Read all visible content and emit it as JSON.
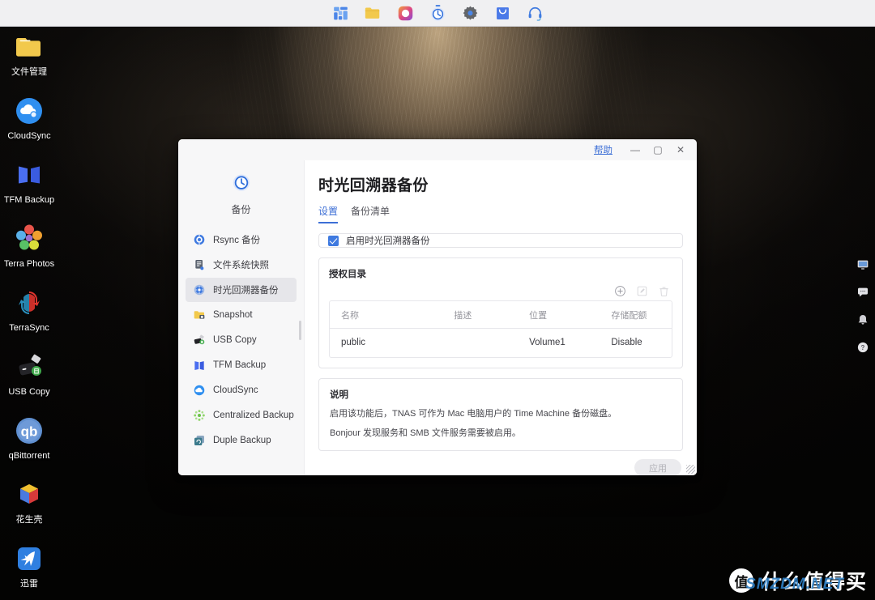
{
  "taskbar": {
    "items": [
      {
        "name": "app-launcher-icon",
        "label": "应用中心"
      },
      {
        "name": "file-manager-icon",
        "label": "文件管理"
      },
      {
        "name": "control-panel-icon",
        "label": "控制面板"
      },
      {
        "name": "backup-icon",
        "label": "备份"
      },
      {
        "name": "settings-gear-icon",
        "label": "设置"
      },
      {
        "name": "download-icon",
        "label": "下载"
      },
      {
        "name": "support-headset-icon",
        "label": "支持"
      }
    ]
  },
  "desktop": {
    "icons": [
      {
        "name": "file-manager",
        "label": "文件管理"
      },
      {
        "name": "cloudsync",
        "label": "CloudSync"
      },
      {
        "name": "tfm-backup",
        "label": "TFM Backup"
      },
      {
        "name": "terra-photos",
        "label": "Terra Photos"
      },
      {
        "name": "terrasync",
        "label": "TerraSync"
      },
      {
        "name": "usb-copy",
        "label": "USB Copy"
      },
      {
        "name": "qbittorrent",
        "label": "qBittorrent"
      },
      {
        "name": "oray-peanut-shell",
        "label": "花生壳"
      },
      {
        "name": "thunder-xunlei",
        "label": "迅雷"
      }
    ]
  },
  "side_tools": [
    {
      "name": "remote-desktop-icon",
      "label": "远程"
    },
    {
      "name": "chat-bubble-icon",
      "label": "消息"
    },
    {
      "name": "notification-bell-icon",
      "label": "通知"
    },
    {
      "name": "help-question-icon",
      "label": "帮助"
    }
  ],
  "window": {
    "help_label": "帮助",
    "minimize_label": "—",
    "maximize_label": "▢",
    "close_label": "✕"
  },
  "nav": {
    "header_label": "备份",
    "items": [
      {
        "label": "Rsync 备份",
        "icon": "rsync-icon",
        "active": false
      },
      {
        "label": "文件系统快照",
        "icon": "filesystem-snapshot-icon",
        "active": false
      },
      {
        "label": "时光回溯器备份",
        "icon": "time-machine-icon",
        "active": true
      },
      {
        "label": "Snapshot",
        "icon": "snapshot-folder-icon",
        "active": false
      },
      {
        "label": "USB Copy",
        "icon": "usb-copy-icon",
        "active": false
      },
      {
        "label": "TFM Backup",
        "icon": "tfm-backup-icon",
        "active": false
      },
      {
        "label": "CloudSync",
        "icon": "cloudsync-icon",
        "active": false
      },
      {
        "label": "Centralized Backup",
        "icon": "centralized-backup-icon",
        "active": false
      },
      {
        "label": "Duple Backup",
        "icon": "duple-backup-icon",
        "active": false
      }
    ]
  },
  "main": {
    "title": "时光回溯器备份",
    "tabs": [
      {
        "label": "设置",
        "active": true
      },
      {
        "label": "备份清单",
        "active": false
      }
    ],
    "enable": {
      "label": "启用时光回溯器备份",
      "checked": true
    },
    "dirs": {
      "title": "授权目录",
      "actions": [
        {
          "name": "add-directory-button",
          "glyph": "⊕",
          "enabled": true
        },
        {
          "name": "edit-directory-button",
          "glyph": "✎",
          "enabled": false
        },
        {
          "name": "delete-directory-button",
          "glyph": "🗑",
          "enabled": false
        }
      ],
      "columns": [
        "名称",
        "描述",
        "位置",
        "存储配额"
      ],
      "rows": [
        {
          "name": "public",
          "desc": "",
          "location": "Volume1",
          "quota": "Disable"
        }
      ]
    },
    "description": {
      "title": "说明",
      "lines": [
        "启用该功能后，TNAS 可作为 Mac 电脑用户的 Time Machine 备份磁盘。",
        "Bonjour 发现服务和 SMB 文件服务需要被启用。"
      ]
    },
    "apply_label": "应用"
  },
  "watermark": {
    "badge": "值",
    "text": "什么值得买",
    "sub": "SMZDM.NET"
  },
  "colors": {
    "accent": "#3d6fd6",
    "checkbox": "#3f7ae0",
    "window_bg": "#f7f7f8",
    "content_bg": "#ffffff",
    "nav_active": "#e6e6ea"
  }
}
